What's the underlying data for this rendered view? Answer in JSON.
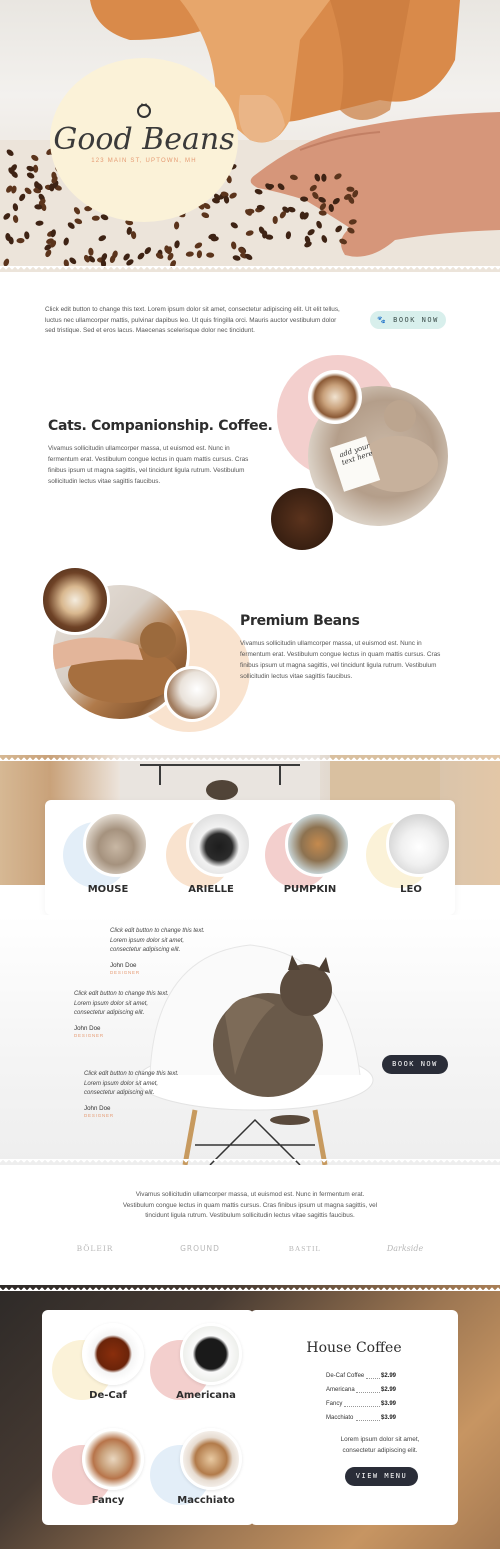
{
  "hero": {
    "brand": "Good Beans",
    "address": "123 MAIN ST, UPTOWN, MH"
  },
  "intro": {
    "text": "Click edit button to change this text. Lorem ipsum dolor sit amet, consectetur adipiscing elit. Ut elit tellus, luctus nec ullamcorper mattis, pulvinar dapibus leo. Ut quis fringilla orci. Mauris auctor vestibulum dolor sed tristique. Sed et eros lacus. Maecenas scelerisque dolor nec tincidunt.",
    "button": "BOOK NOW"
  },
  "section1": {
    "title": "Cats. Companionship. Coffee.",
    "text": "Vivamus sollicitudin ullamcorper massa, ut euismod est. Nunc in fermentum erat. Vestibulum congue lectus in quam mattis cursus. Cras finibus ipsum ut magna sagittis, vel tincidunt ligula rutrum. Vestibulum sollicitudin lectus vitae sagittis faucibus.",
    "note": "add your text here"
  },
  "section2": {
    "title": "Premium Beans",
    "text": "Vivamus sollicitudin ullamcorper massa, ut euismod est. Nunc in fermentum erat. Vestibulum congue lectus in quam mattis cursus. Cras finibus ipsum ut magna sagittis, vel tincidunt ligula rutrum. Vestibulum sollicitudin lectus vitae sagittis faucibus."
  },
  "cats": [
    {
      "name": "MOUSE"
    },
    {
      "name": "ARIELLE"
    },
    {
      "name": "PUMPKIN"
    },
    {
      "name": "LEO"
    }
  ],
  "testimonials": [
    {
      "text": "Click edit button to change this text. Lorem ipsum dolor sit amet, consectetur adipiscing elit.",
      "name": "John Doe",
      "role": "DESIGNER"
    },
    {
      "text": "Click edit button to change this text. Lorem ipsum dolor sit amet, consectetur adipiscing elit.",
      "name": "John Doe",
      "role": "DESIGNER"
    },
    {
      "text": "Click edit button to change this text. Lorem ipsum dolor sit amet, consectetur adipiscing elit.",
      "name": "John Doe",
      "role": "DESIGNER"
    }
  ],
  "book_button": "BOOK NOW",
  "partners": {
    "text": "Vivamus sollicitudin ullamcorper massa, ut euismod est. Nunc in fermentum erat. Vestibulum congue lectus in quam mattis cursus. Cras finibus ipsum ut magna sagittis, vel tincidunt ligula rutrum. Vestibulum sollicitudin lectus vitae sagittis faucibus.",
    "logos": [
      "BÖLEIR",
      "GROUND",
      "BASTIL",
      "Darkside"
    ]
  },
  "menu": {
    "items": [
      {
        "name": "De-Caf"
      },
      {
        "name": "Americana"
      },
      {
        "name": "Fancy"
      },
      {
        "name": "Macchiato"
      }
    ],
    "title": "House Coffee",
    "prices": [
      {
        "item": "De-Caf Coffee",
        "price": "$2.99"
      },
      {
        "item": "Americana",
        "price": "$2.99"
      },
      {
        "item": "Fancy",
        "price": "$3.99"
      },
      {
        "item": "Macchiato",
        "price": "$3.99"
      }
    ],
    "text": "Lorem ipsum dolor sit amet, consectetur adipiscing elit.",
    "button": "VIEW MENU"
  },
  "colors": {
    "accent_teal": "#d8efec",
    "pink": "#f3cfcd",
    "peach": "#f9e3cf",
    "cream": "#fbf2d8",
    "blue": "#e3eef8",
    "dark": "#2a2d38",
    "orange": "#e59a72"
  }
}
